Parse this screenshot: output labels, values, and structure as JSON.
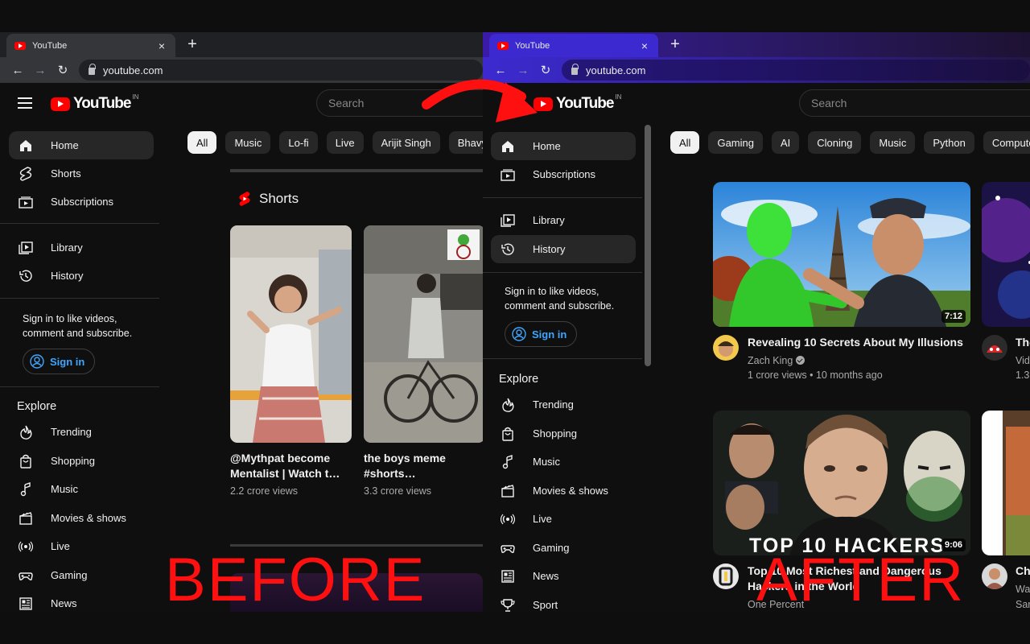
{
  "colors": {
    "yt_red": "#ff0000",
    "link_blue": "#3ea6ff",
    "bg": "#0f0f0f",
    "chip_bg": "#272727",
    "caption_red": "#ff1010",
    "after_chrome": "#3c2ad0"
  },
  "browser": {
    "tab_title": "YouTube",
    "tab_close": "×",
    "new_tab": "+",
    "url": "youtube.com",
    "back": "←",
    "forward": "→",
    "reload": "↻"
  },
  "youtube": {
    "logo_text": "YouTube",
    "country_code": "IN",
    "search_placeholder": "Search"
  },
  "before": {
    "chips": [
      "All",
      "Music",
      "Lo-fi",
      "Live",
      "Arijit Singh",
      "Bhavya"
    ],
    "guide": [
      {
        "label": "Home",
        "icon": "home-icon"
      },
      {
        "label": "Shorts",
        "icon": "shorts-icon"
      },
      {
        "label": "Subscriptions",
        "icon": "subscriptions-icon"
      },
      {
        "label": "Library",
        "icon": "library-icon"
      },
      {
        "label": "History",
        "icon": "history-icon"
      }
    ],
    "signin_prompt": "Sign in to like videos, comment and subscribe.",
    "signin_button": "Sign in",
    "explore_heading": "Explore",
    "explore": [
      {
        "label": "Trending",
        "icon": "trending-icon"
      },
      {
        "label": "Shopping",
        "icon": "shopping-icon"
      },
      {
        "label": "Music",
        "icon": "music-icon"
      },
      {
        "label": "Movies & shows",
        "icon": "movies-icon"
      },
      {
        "label": "Live",
        "icon": "live-icon"
      },
      {
        "label": "Gaming",
        "icon": "gaming-icon"
      },
      {
        "label": "News",
        "icon": "news-icon"
      }
    ],
    "shorts_heading": "Shorts",
    "shorts": [
      {
        "title": "@Mythpat become Mentalist | Watch t…",
        "views": "2.2 crore views"
      },
      {
        "title": "the boys meme #shorts…",
        "views": "3.3 crore views"
      }
    ],
    "caption": "BEFORE"
  },
  "after": {
    "chips": [
      "All",
      "Gaming",
      "AI",
      "Cloning",
      "Music",
      "Python",
      "Computer"
    ],
    "guide": [
      {
        "label": "Home",
        "icon": "home-icon"
      },
      {
        "label": "Subscriptions",
        "icon": "subscriptions-icon"
      },
      {
        "label": "Library",
        "icon": "library-icon"
      },
      {
        "label": "History",
        "icon": "history-icon"
      }
    ],
    "signin_prompt": "Sign in to like videos, comment and subscribe.",
    "signin_button": "Sign in",
    "explore_heading": "Explore",
    "explore": [
      {
        "label": "Trending",
        "icon": "trending-icon"
      },
      {
        "label": "Shopping",
        "icon": "shopping-icon"
      },
      {
        "label": "Music",
        "icon": "music-icon"
      },
      {
        "label": "Movies & shows",
        "icon": "movies-icon"
      },
      {
        "label": "Live",
        "icon": "live-icon"
      },
      {
        "label": "Gaming",
        "icon": "gaming-icon"
      },
      {
        "label": "News",
        "icon": "news-icon"
      },
      {
        "label": "Sport",
        "icon": "sport-icon"
      }
    ],
    "videos": [
      {
        "title": "Revealing 10 Secrets About My Illusions",
        "channel": "Zach King",
        "meta": "1 crore views • 10 months ago",
        "duration": "7:12"
      },
      {
        "title": "Top 10 Most Richest and Dangerous Hackers in the World",
        "channel": "One Percent",
        "duration": "9:06",
        "thumb_text": "TOP 10 HACKERS"
      }
    ],
    "partial_videos": [
      {
        "title": "The",
        "meta1": "Vid",
        "meta2": "1.3"
      },
      {
        "title": "Ch",
        "meta1": "Wa",
        "meta2": "Sar"
      }
    ],
    "caption": "AFTER"
  }
}
